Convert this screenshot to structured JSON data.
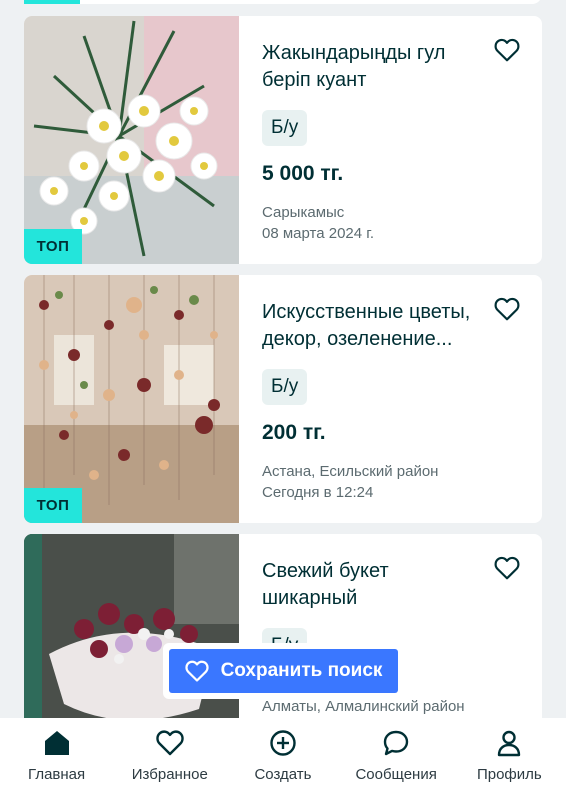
{
  "listings": [
    {
      "title": "Жакындарыңды гул беріп куант",
      "condition": "Б/у",
      "price": "5 000 тг.",
      "location": "Сарыкамыс",
      "date": "08 марта 2024 г.",
      "badge": "ТОП"
    },
    {
      "title": "Искусственные цветы, декор, озеленение...",
      "condition": "Б/у",
      "price": "200 тг.",
      "location": "Астана, Есильский район",
      "date": "Сегодня в 12:24",
      "badge": "ТОП"
    },
    {
      "title": "Свежий букет шикарный",
      "condition": "Б/у",
      "location": "Алматы, Алмалинский район"
    }
  ],
  "save_search": {
    "label": "Сохранить поиск",
    "icon": "heart-icon"
  },
  "nav": {
    "items": [
      {
        "label": "Главная",
        "icon": "home-icon"
      },
      {
        "label": "Избранное",
        "icon": "heart-icon"
      },
      {
        "label": "Создать",
        "icon": "plus-circle-icon"
      },
      {
        "label": "Сообщения",
        "icon": "chat-icon"
      },
      {
        "label": "Профиль",
        "icon": "user-icon"
      }
    ]
  },
  "colors": {
    "badge": "#23e5db",
    "price": "#002f34",
    "save_button": "#3a77ff",
    "background": "#eef1f3"
  }
}
